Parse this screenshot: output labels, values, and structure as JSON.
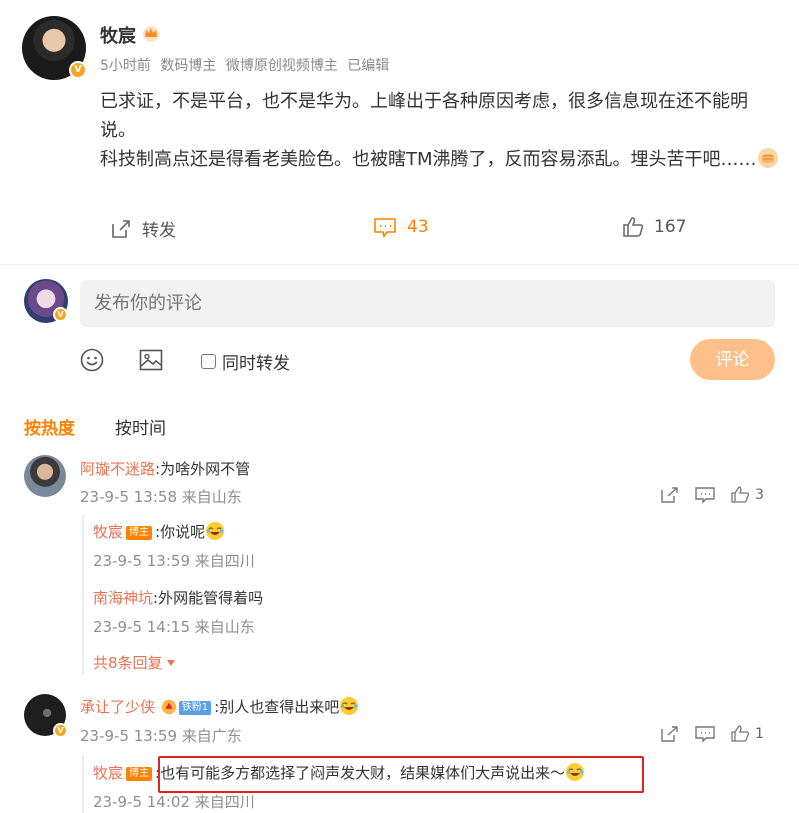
{
  "post": {
    "author": "牧宸",
    "meta": [
      "5小时前",
      "数码博主",
      "微博原创视频博主",
      "已编辑"
    ],
    "paragraph1": "已求证，不是平台，也不是华为。上峰出于各种原因考虑，很多信息现在还不能明说。",
    "paragraph2": "科技制高点还是得看老美脸色。也被瞎TM沸腾了，反而容易添乱。埋头苦干吧……",
    "actions": {
      "repost": "转发",
      "comments": "43",
      "likes": "167"
    }
  },
  "composer": {
    "placeholder": "发布你的评论",
    "repost_label": "同时转发",
    "submit": "评论"
  },
  "sort": {
    "hot": "按热度",
    "time": "按时间"
  },
  "comments": [
    {
      "user": "阿璇不迷路",
      "text": ":为啥外网不管",
      "time": "23-9-5 13:58 来自山东",
      "likes": "3",
      "replies": [
        {
          "user": "牧宸",
          "tag": "博主",
          "text": ":你说呢",
          "time": "23-9-5 13:59 来自四川"
        },
        {
          "user": "南海神坑",
          "text": ":外网能管得着吗",
          "time": "23-9-5 14:15 来自山东"
        }
      ],
      "more": "共8条回复"
    },
    {
      "user": "承让了少侠",
      "fan_tag": "铁粉1",
      "text": ":别人也查得出来吧",
      "time": "23-9-5 13:59 来自广东",
      "likes": "1",
      "replies": [
        {
          "user": "牧宸",
          "tag": "博主",
          "text": ":也有可能多方都选择了闷声发大财，结果媒体们大声说出来～",
          "time": "23-9-5 14:02 来自四川"
        }
      ]
    }
  ],
  "colors": {
    "accent": "#ff8200",
    "username": "#eb7350",
    "highlight": "#e0231d"
  }
}
